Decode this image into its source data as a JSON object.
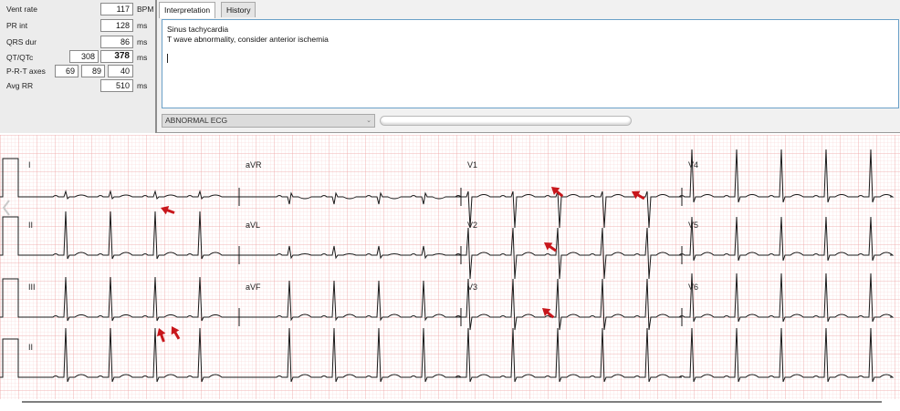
{
  "measurements": {
    "vent_rate": {
      "label": "Vent rate",
      "value": "117",
      "unit": "BPM"
    },
    "pr_int": {
      "label": "PR int",
      "value": "128",
      "unit": "ms"
    },
    "qrs_dur": {
      "label": "QRS dur",
      "value": "86",
      "unit": "ms"
    },
    "qt_qtc": {
      "label": "QT/QTc",
      "qt": "308",
      "qtc": "378",
      "unit": "ms"
    },
    "axes": {
      "label": "P-R-T axes",
      "p": "69",
      "r": "89",
      "t": "40"
    },
    "avg_rr": {
      "label": "Avg RR",
      "value": "510",
      "unit": "ms"
    }
  },
  "tabs": [
    {
      "label": "Interpretation",
      "active": true
    },
    {
      "label": "History",
      "active": false
    }
  ],
  "interpretation": {
    "lines": [
      "Sinus tachycardia",
      "T wave abnormality, consider anterior ischemia"
    ]
  },
  "classification": {
    "value": "ABNORMAL ECG"
  },
  "leads": {
    "row1": [
      "I",
      "aVR",
      "V1",
      "V4"
    ],
    "row2": [
      "II",
      "aVL",
      "V2",
      "V5"
    ],
    "row3": [
      "III",
      "aVF",
      "V3",
      "V6"
    ],
    "rhythm": "II"
  },
  "colors": {
    "grid_minor": "#f7d0d0",
    "grid_major": "#eea5a5",
    "trace": "#1a1a1a",
    "arrow": "#c8161b",
    "accent_border": "#6aa0c8"
  }
}
